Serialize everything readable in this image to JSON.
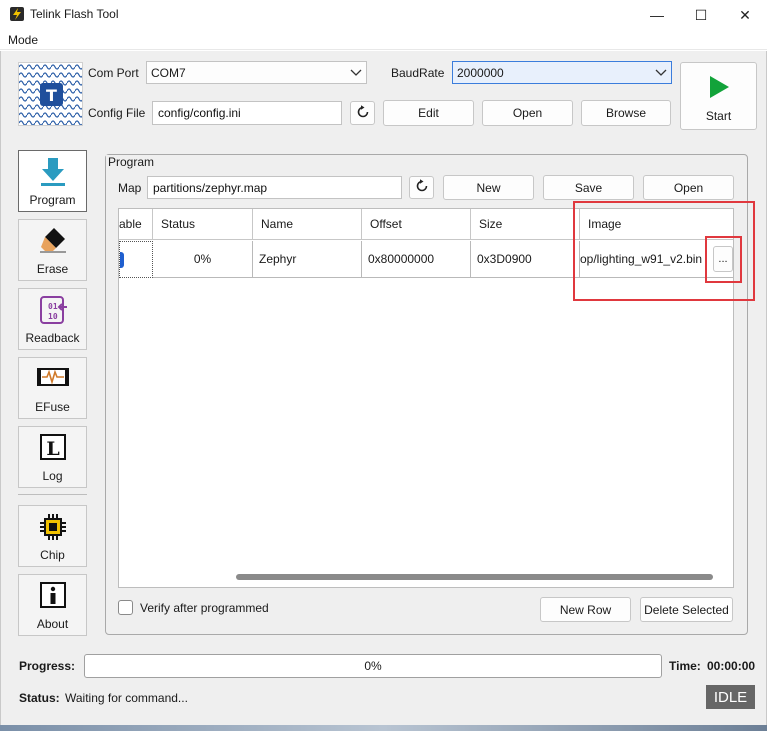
{
  "window": {
    "title": "Telink Flash Tool",
    "minimize_glyph": "—",
    "maximize_glyph": "☐",
    "close_glyph": "✕"
  },
  "menubar": {
    "items": [
      {
        "label": "Mode"
      }
    ]
  },
  "config": {
    "com_port_label": "Com Port",
    "com_port_value": "COM7",
    "baud_label": "BaudRate",
    "baud_value": "2000000",
    "config_file_label": "Config File",
    "config_file_value": "config/config.ini",
    "edit_label": "Edit",
    "open_label": "Open",
    "browse_label": "Browse"
  },
  "start": {
    "label": "Start",
    "color": "#12a33a"
  },
  "tools": [
    {
      "label": "Program",
      "icon": "download-arrow-icon",
      "active": true
    },
    {
      "label": "Erase",
      "icon": "eraser-icon"
    },
    {
      "label": "Readback",
      "icon": "binary-readback-icon"
    },
    {
      "label": "EFuse",
      "icon": "efuse-icon"
    },
    {
      "label": "Log",
      "icon": "log-icon"
    },
    {
      "label": "Chip",
      "icon": "chip-icon"
    },
    {
      "label": "About",
      "icon": "info-icon"
    }
  ],
  "program": {
    "group_title": "Program",
    "map_label": "Map",
    "map_value": "partitions/zephyr.map",
    "new_label": "New",
    "save_label": "Save",
    "open_label": "Open",
    "columns": [
      "able",
      "Status",
      "Name",
      "Offset",
      "Size",
      "Image"
    ],
    "rows": [
      {
        "status": "0%",
        "name": "Zephyr",
        "offset": "0x80000000",
        "size": "0x3D0900",
        "image": "op/lighting_w91_v2.bin",
        "browse": "..."
      }
    ],
    "verify_label": "Verify after programmed",
    "new_row_label": "New Row",
    "delete_selected_label": "Delete Selected"
  },
  "footer": {
    "progress_label": "Progress:",
    "progress_text": "0%",
    "progress_value": 0,
    "time_label": "Time:",
    "time_value": "00:00:00",
    "status_label": "Status:",
    "status_text": "Waiting for command...",
    "state_badge": "IDLE"
  },
  "colors": {
    "highlight_box": "#e0383e",
    "program_icon": "#2a9bc0",
    "readback_icon": "#8a3fa0"
  }
}
